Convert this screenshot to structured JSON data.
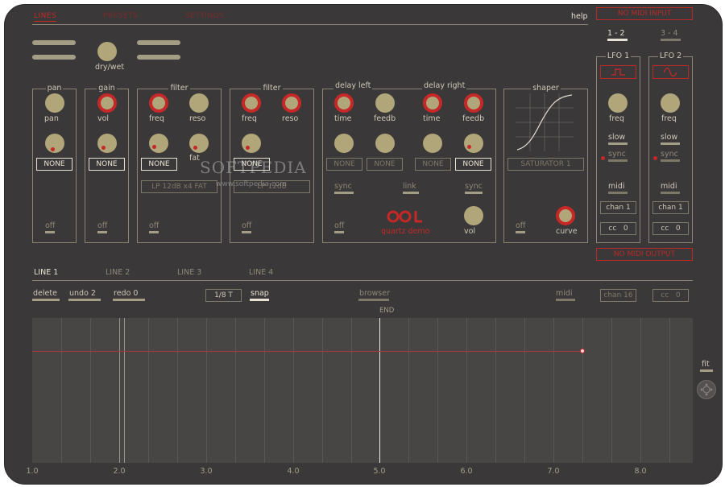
{
  "menu": {
    "lines": "LINES",
    "presets": "PRESETS",
    "settings": "SETTINGS",
    "help": "help"
  },
  "midi_in": "NO MIDI INPUT",
  "midi_out": "NO MIDI OUTPUT",
  "drywet": "dry/wet",
  "pan_panel": {
    "title": "pan",
    "knob": "pan",
    "assign": "NONE",
    "off": "off"
  },
  "gain_panel": {
    "title": "gain",
    "knob": "vol",
    "assign": "NONE",
    "off": "off"
  },
  "filter1": {
    "title": "filter",
    "freq": "freq",
    "reso": "reso",
    "fat": "fat",
    "assign": "NONE",
    "type": "LP 12dB x4 FAT",
    "off": "off"
  },
  "filter2": {
    "title": "filter",
    "freq": "freq",
    "reso": "reso",
    "assign": "NONE",
    "type": "LP 12dB",
    "off": "off"
  },
  "delay_left": {
    "title": "delay left",
    "time": "time",
    "feedb": "feedb",
    "assign1": "NONE",
    "assign2": "NONE",
    "sync": "sync",
    "off": "off"
  },
  "delay_right": {
    "title": "delay right",
    "time": "time",
    "feedb": "feedb",
    "assign1": "NONE",
    "assign2": "NONE",
    "sync": "sync",
    "vol": "vol"
  },
  "link": "link",
  "brand": "quartz demo",
  "shaper": {
    "title": "shaper",
    "type": "SATURATOR 1",
    "off": "off",
    "curve": "curve"
  },
  "lfo_tabs": [
    "1 - 2",
    "3 - 4"
  ],
  "lfo1": {
    "title": "LFO 1",
    "freq": "freq",
    "slow": "slow",
    "sync": "sync",
    "midi": "midi",
    "chan": "chan 1",
    "cc": "cc",
    "cc_val": "0"
  },
  "lfo2": {
    "title": "LFO 2",
    "freq": "freq",
    "slow": "slow",
    "sync": "sync",
    "midi": "midi",
    "chan": "chan 1",
    "cc": "cc",
    "cc_val": "0"
  },
  "line_tabs": [
    "LINE 1",
    "LINE 2",
    "LINE 3",
    "LINE 4"
  ],
  "toolbar": {
    "delete": "delete",
    "undo": "undo 2",
    "redo": "redo 0",
    "grid": "1/8 T",
    "snap": "snap",
    "browser": "browser",
    "midi": "midi",
    "chan": "chan 16",
    "cc": "cc",
    "cc_val": "0",
    "end": "END",
    "fit": "fit"
  },
  "timeline_ticks": [
    "1.0",
    "2.0",
    "3.0",
    "4.0",
    "5.0",
    "6.0",
    "7.0",
    "8.0"
  ],
  "watermark": "SOFTPEDIA",
  "watermark_url": "www.softpedia.com"
}
